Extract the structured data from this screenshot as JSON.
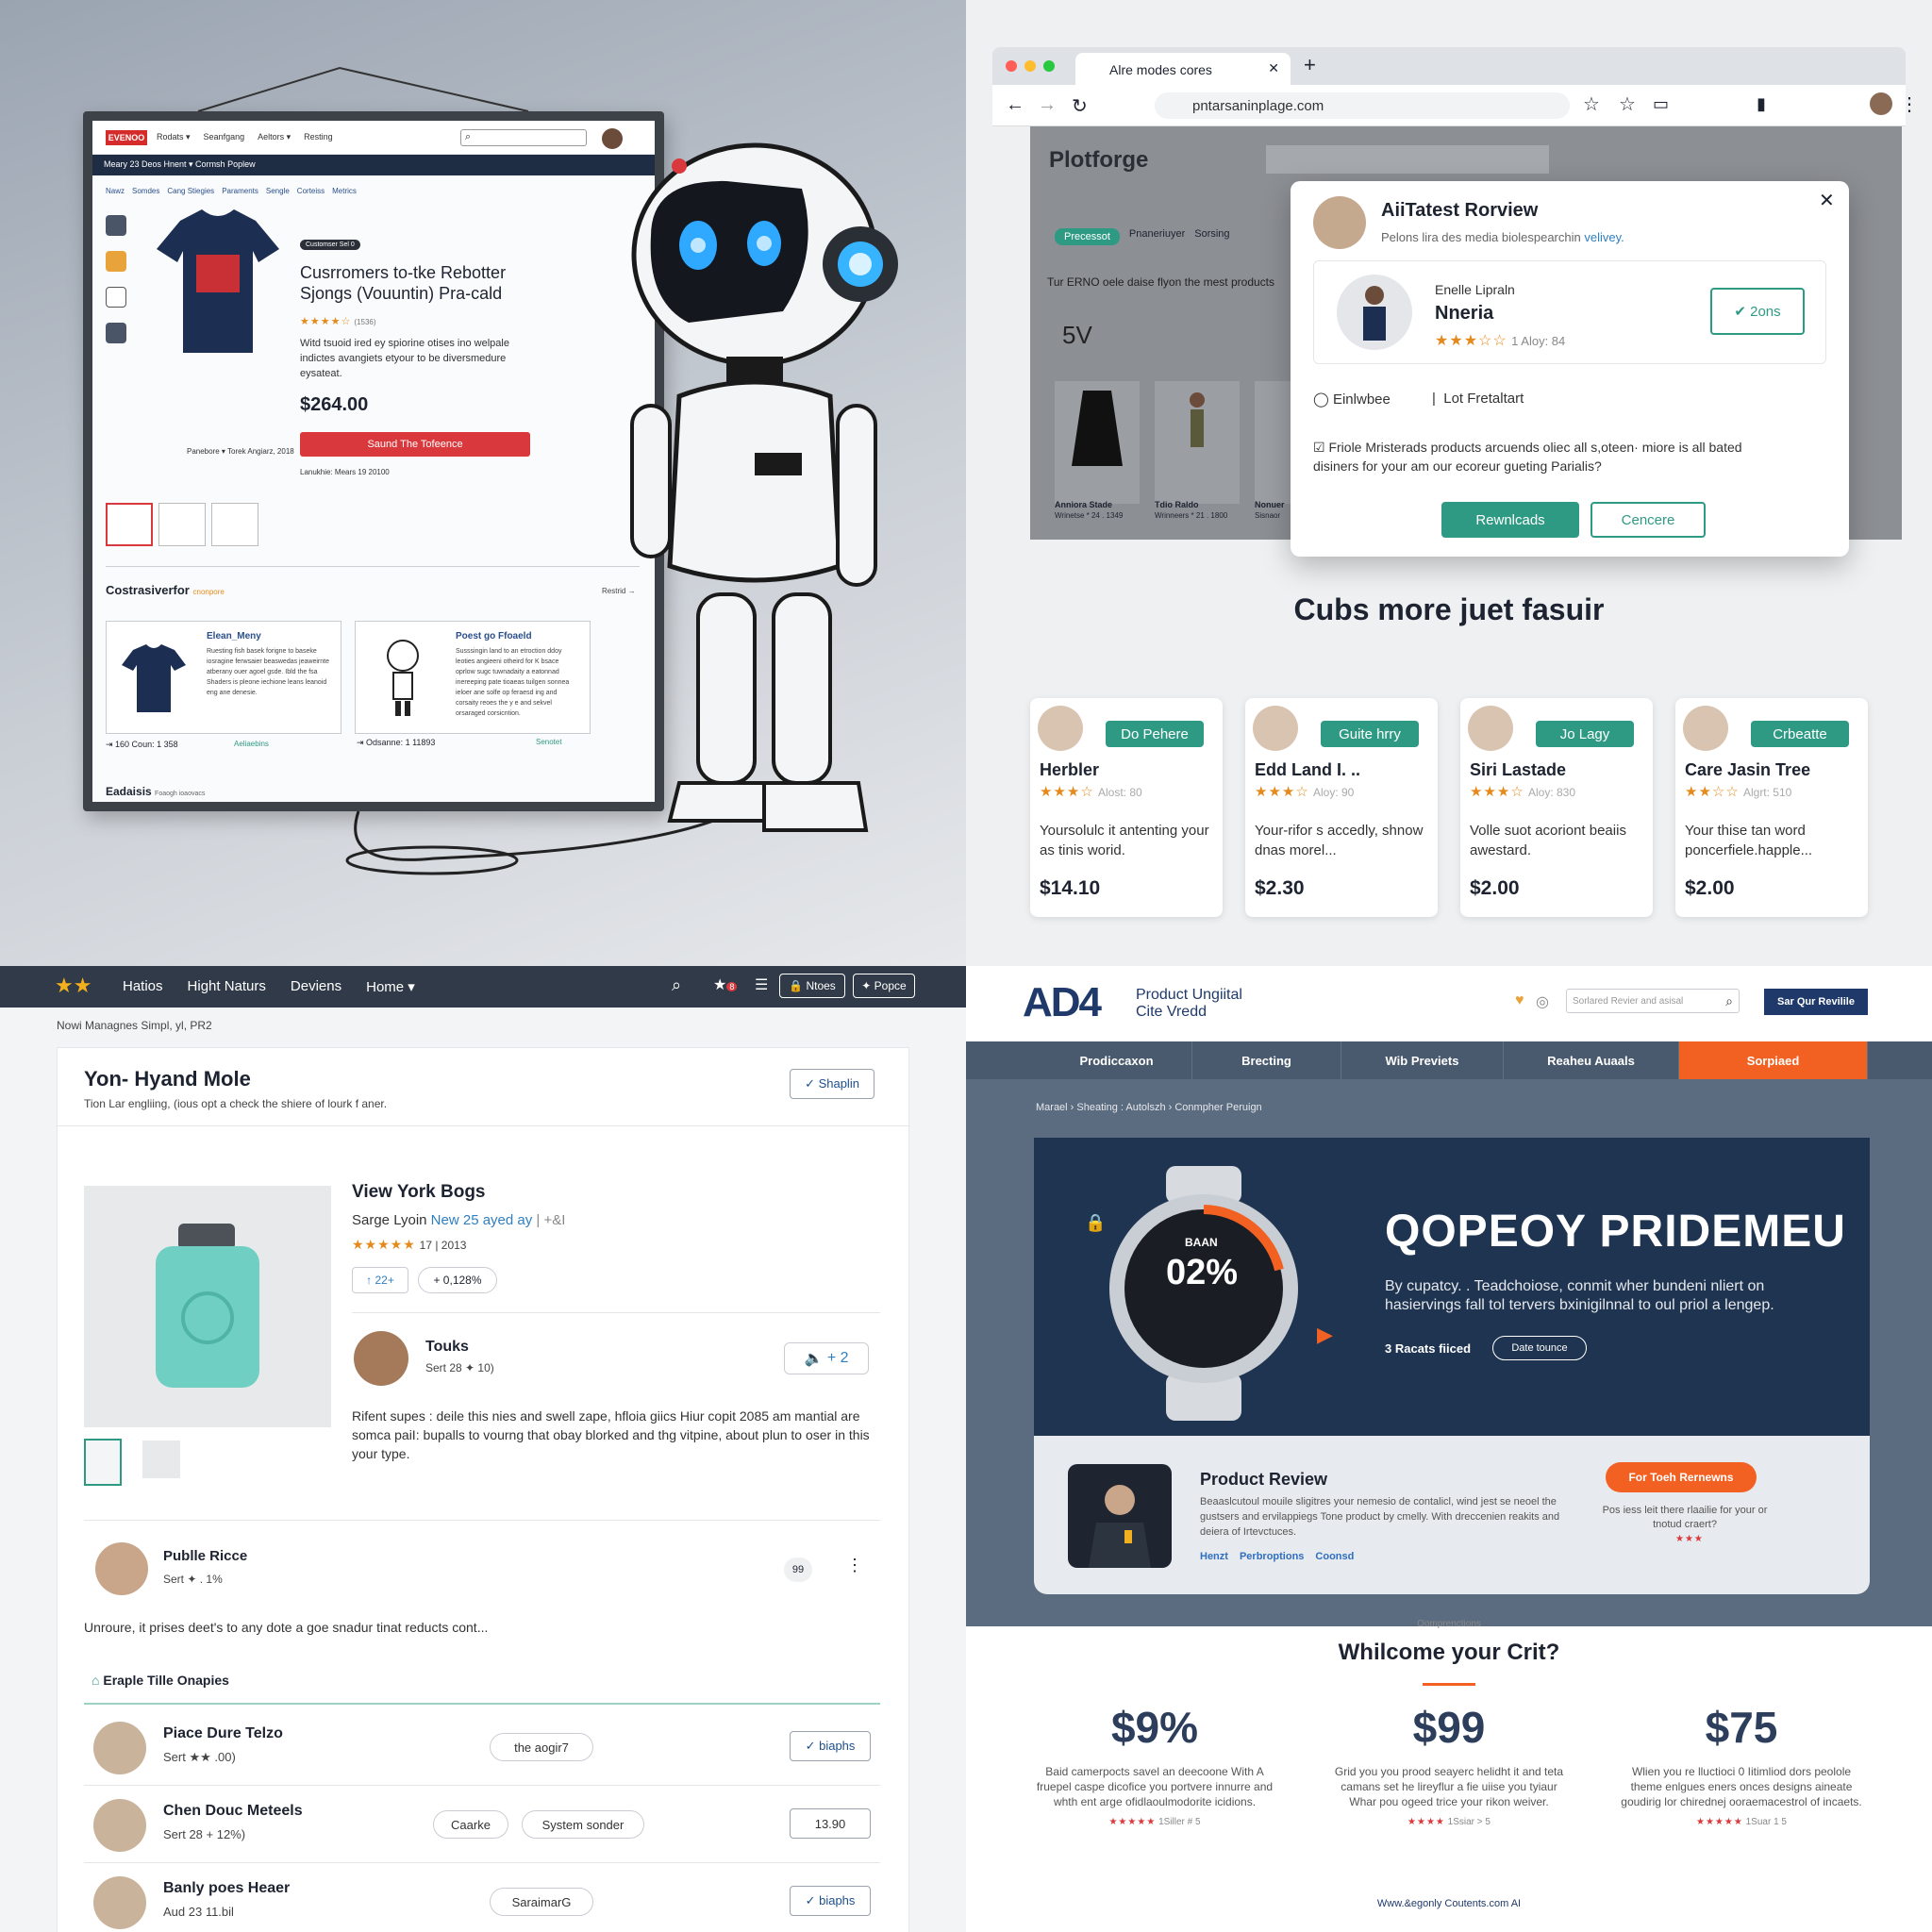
{
  "q1": {
    "logo": "EVENOO",
    "nav": [
      "Rodats ▾",
      "Seanfgang",
      "Aeltors ▾",
      "Resting"
    ],
    "bar2": "Meary 23 Deos   Hnent ▾   Cormsh Poplew",
    "crumbs": [
      "Nawz",
      "Somdes",
      "Cang Stiegies",
      "Paraments",
      "Sengle",
      "Corteiss",
      "Metrics"
    ],
    "badge": "Customser Sel 0",
    "title": "Cusrromers to-tke Rebotter Sjongs (Vouuntin) Pra-cald",
    "rating": "★★★★☆",
    "rating_count": "(1536)",
    "description": "Witd tsuoid ired ey spiorine otises ino welpale indictes avangiets etyour to be diversmedure eysateat.",
    "price": "$264.00",
    "buy_label": "Saund The Tofeence",
    "buy_note": "Lanukhie: Mears 19 20100",
    "caption": "Panebore ▾ Torek Angiarz, 2018",
    "section": "Costrasiverfor",
    "section_tag": "cnonpore",
    "more": "Restrid",
    "card1": {
      "title": "Elean_Meny",
      "desc": "Ruesting fish basek forigne to baseke iosragine ferwsaier beaswedas jeaweirnte atberany ouer agoel gsde. Ibld the fsa Shaders is pleone iechione leans leanoid eng ane denesie.",
      "meta": "⇥ 160 Coun: 1 358",
      "tag": "Aeliaebins"
    },
    "card2": {
      "title": "Poest go Ffoaeld",
      "desc": "Susssingin land to an etroction ddoy leoties angieeni otheird for K bsace oprlow sugc tuwnadaity a eatonnad inereeping pate tioaeas tuilgen sonnea ieloer ane solfe op feraesd ing and corsaity reoes the y e and sekvel orsaraged corsicntion.",
      "meta": "⇥ Odsanne: 1 11893",
      "tag": "Senotet"
    },
    "footer": "Eadaisis",
    "footer_tag": "Foaogh ioaovacs"
  },
  "q2": {
    "tab_title": "Alre modes cores",
    "url": "pntarsaninplage.com",
    "site_name": "Plotforge",
    "behind_tabs": [
      "Precessot",
      "Pnaneriuyer",
      "Sorsing"
    ],
    "behind_text": "Tur ERNO oele daise flyon the mest products",
    "behind_rating": "5V",
    "behind_items": [
      {
        "name": "Anniora Stade",
        "meta": "Wrinetse * 24 . 1349"
      },
      {
        "name": "Tdio Raldo",
        "meta": "Wrinneers * 21 . 1800"
      },
      {
        "name": "Nonuer",
        "meta": "Sisnaor"
      }
    ],
    "modal": {
      "title": "AiiTatest Rorview",
      "subtitle": "Pelons lira des media biolespearchin",
      "subtitle_link": "velivey.",
      "reviewer_label": "Enelle Lipraln",
      "reviewer_name": "Nneria",
      "stars": "★★★☆☆",
      "meta": "1 Aloy: 84",
      "badge": "2ons",
      "radio1": "Einlwbee",
      "radio2": "Lot Fretaltart",
      "check_text": "Friole Mristerads products arcuends oliec all s,oteen· miore is all bated disiners for your am our ecoreur gueting Parialis?",
      "primary": "Rewnlcads",
      "secondary": "Cencere"
    },
    "heading": "Cubs more juet fasuir",
    "cards": [
      {
        "tag": "Do Pehere",
        "name": "Herbler",
        "stars": "★★★☆",
        "meta": "Alost: 80",
        "desc": "Yoursolulc it antenting your as tinis worid.",
        "price": "$14.10"
      },
      {
        "tag": "Guite hrry",
        "name": "Edd Land I. ..",
        "stars": "★★★☆",
        "meta": "Aloy: 90",
        "desc": "Your-rifor s accedly, shnow dnas morel...",
        "price": "$2.30"
      },
      {
        "tag": "Jo Lagy",
        "name": "Siri Lastade",
        "stars": "★★★☆",
        "meta": "Aloy: 830",
        "desc": "Volle suot acoriont beaiis awestard.",
        "price": "$2.00"
      },
      {
        "tag": "Crbeatte",
        "name": "Care Jasin Tree",
        "stars": "★★☆☆",
        "meta": "Algrt: 510",
        "desc": "Your thise tan word poncerfiele.happle...",
        "price": "$2.00"
      }
    ]
  },
  "q3": {
    "nav": [
      "Hatios",
      "Hight Naturs",
      "Deviens",
      "Home ▾"
    ],
    "nav_btn1": "🔒 Ntoes",
    "nav_btn2": "✦ Popce",
    "badge_count": "8",
    "crumb": "Nowi Managnes  Simpl,  yl,  PR2",
    "title": "Yon- Hyand Mole",
    "subtitle": "Tion Lar engliing, (ious opt a check the shiere of lourk f aner.",
    "share": "✓ Shaplin",
    "product_name": "View York Bogs",
    "product_by": "Sarge Lyoin",
    "product_by_link": "New 25 ayed ay",
    "product_by_extra": "| +&I",
    "product_stars": "★★★★★",
    "product_meta": "17 | 2013",
    "vote_up": "↑ 22+",
    "vote_pct": "+ 0,128%",
    "author": "Touks",
    "author_meta": "Sert 28 ✦ 10)",
    "counter": "+ 2",
    "body": "Rifent supes : deile this nies and swell zape, hfloia giics Hiur copit 2085 am mantial are somca paiI: bupalls to vourng that obay blorked and thg vitpine, about plun to oser in this your type.",
    "comment_name": "Publle Ricce",
    "comment_meta": "Sert ✦ . 1%",
    "comment_text": "Unroure, it prises deet's to any dote a goe snadur tinat reducts cont...",
    "section": "Eraple Tille  Onapies",
    "rows": [
      {
        "name": "Piace Dure Telzo",
        "meta": "Sert ★★ .00)",
        "pill": "the aogir7",
        "btn": "✓ biaphs"
      },
      {
        "name": "Chen Douc Meteels",
        "meta": "Sert 28 + 12%)",
        "pill": "Caarke",
        "pill2": "System sonder",
        "btn": "13.90"
      },
      {
        "name": "Banly poes Heaer",
        "meta": "Aud 23 11.bil",
        "pill": "SaraimarG",
        "btn": "✓ biaphs"
      }
    ]
  },
  "q4": {
    "logo": "AD4",
    "logo_sub1": "Product Ungiital",
    "logo_sub2": "Cite Vredd",
    "search_placeholder": "Sorlared Revier and asisal",
    "cta": "Sar Qur Revilile",
    "nav": [
      "Prodiccaxon",
      "Brecting",
      "Wib Previets",
      "Reaheu Auaals",
      "Sorpiaed"
    ],
    "crumb": "Marael  ›  Sheating : Autolszh  ›  Conmpher Peruign",
    "watch_brand": "BAAN",
    "watch_value": "02%",
    "hero_title": "QOPEOY PRIDEMEU",
    "hero_text": "By cupatcy. . Teadchoiose, conmit wher bundeni nliert on hasiervings fall tol tervers bxinigilnnal to oul priol a lengep.",
    "hero_link": "3 Racats fiiced",
    "hero_btn": "Date tounce",
    "review_title": "Product Review",
    "review_text": "Beaaslcutoul mouile sligitres your nemesio de contalicl, wind jest se neoel the gustsers and ervilappiegs Tone product by cmelly. With dreccenien reakits and deiera of Irtevctuces.",
    "review_links": [
      "Henzt",
      "Perbroptions",
      "Coonsd"
    ],
    "review_btn": "For Toeh Rernewns",
    "review_side": "Pos iess leit there rlaailie for your or tnotud craert?",
    "review_side_stars": "★★★",
    "pre_heading": "Oomprenctions",
    "heading": "Whilcome your Crit?",
    "stats": [
      {
        "value": "$9%",
        "desc": "Baid camerpocts savel an deecoone With A fruepel caspe dicofice you portvere innurre and whth ent arge ofidlaoulmodorite icidions.",
        "stars": "★★★★★",
        "meta": "1Siller # 5"
      },
      {
        "value": "$99",
        "desc": "Grid you you prood seayerc helidht it and teta camans set he lireyflur a fie uiise you tyiaur Whar pou ogeed trice your rikon weiver.",
        "stars": "★★★★",
        "meta": "1Ssiar > 5"
      },
      {
        "value": "$75",
        "desc": "Wlien you re lluctioci 0 Iitimliod dors peolole theme enlgues eners onces designs aineate goudirig lor chirednej ooraemacestrol of incaets.",
        "stars": "★★★★★",
        "meta": "1Suar 1 5"
      }
    ],
    "footer": "Www.&egonly Coutents.com AI"
  },
  "colors": {
    "red": "#d9383c",
    "teal": "#2f9a84",
    "orange": "#f26122",
    "navy": "#1e3451"
  }
}
